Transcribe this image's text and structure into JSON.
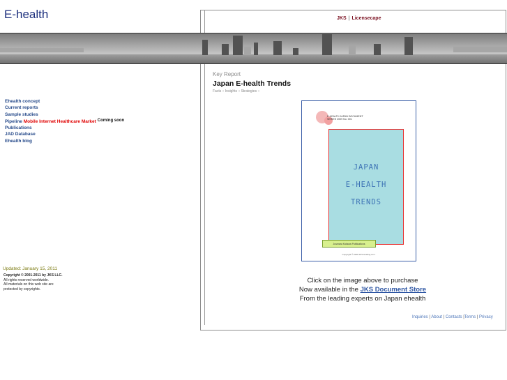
{
  "site": {
    "title": "E-health"
  },
  "toplinks": [
    {
      "label": "JKS"
    },
    {
      "label": "Licensecape"
    }
  ],
  "sidebar": {
    "nav": [
      {
        "label": "Ehealth concept"
      },
      {
        "label": "Current reports"
      },
      {
        "label": "Sample studies"
      },
      {
        "label": "Pipeline",
        "highlight": "Mobile Internet Healthcare Market",
        "note": "Coming soon"
      },
      {
        "label": "Publications"
      },
      {
        "label": "JAD Database"
      },
      {
        "label": "Ehealth blog"
      }
    ],
    "updated": "Updated: January 15, 2011",
    "copyright": {
      "line1": "Copyright © 2001-2011 by JKS LLC.",
      "line2": "All rights reserved worldwide.",
      "line3": "All materials on this web site are",
      "line4": "protected by copyrights."
    }
  },
  "main": {
    "label": "Key Report",
    "title": "Japan E-health Trends",
    "subtitle": "Facts :: Insights :: Strategies ::",
    "cover": {
      "header_line1": "E-HEALTH JAPAN DOCUMENT",
      "header_line2": "SERIES 2009 No. 001",
      "big_lines": [
        "JAPAN",
        "E-HEALTH",
        "TRENDS"
      ],
      "tag": "Jusmara Kotawa Publications",
      "footer": "Copyright © 2009 JKS Holding LLC."
    },
    "cta": {
      "line1": "Click on the image above to purchase",
      "line2_prefix": "Now available in the ",
      "line2_link": "JKS Document Store",
      "line3": "From the leading experts on Japan ehealth"
    }
  },
  "footer": {
    "links": [
      {
        "label": "Inquiries"
      },
      {
        "label": "About"
      },
      {
        "label": "Contacts"
      },
      {
        "label": "Terms"
      },
      {
        "label": "Privacy"
      }
    ]
  },
  "colors": {
    "title": "#1c2f7d",
    "nav": "#264a8a",
    "highlight": "#e00000",
    "link": "#2e56a3",
    "updated": "#7b7a10"
  }
}
